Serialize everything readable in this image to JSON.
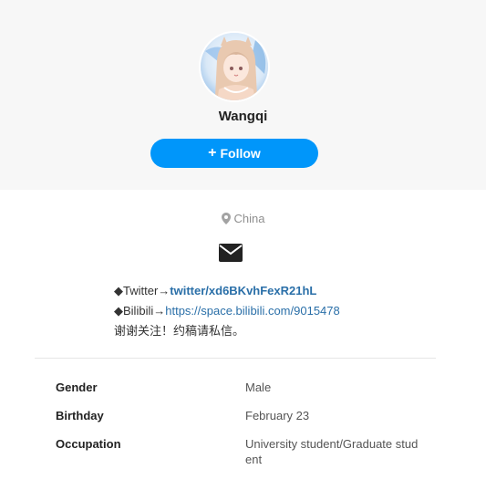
{
  "profile": {
    "username": "Wangqi",
    "follow_label": "Follow",
    "location": "China"
  },
  "bio": {
    "twitter_prefix": "◆Twitter→",
    "twitter_link": "twitter/xd6BKvhFexR21hL",
    "bilibili_prefix": "◆Bilibili→",
    "bilibili_link": "https://space.bilibili.com/9015478",
    "note": "谢谢关注！约稿请私信。"
  },
  "details": [
    {
      "label": "Gender",
      "value": "Male"
    },
    {
      "label": "Birthday",
      "value": "February 23"
    },
    {
      "label": "Occupation",
      "value": "University student/Graduate student"
    }
  ],
  "colors": {
    "accent": "#0096fa",
    "link": "#2a6fa8",
    "header_bg": "#f7f7f7"
  },
  "icons": [
    "location-pin-icon",
    "mail-icon",
    "plus-icon"
  ]
}
